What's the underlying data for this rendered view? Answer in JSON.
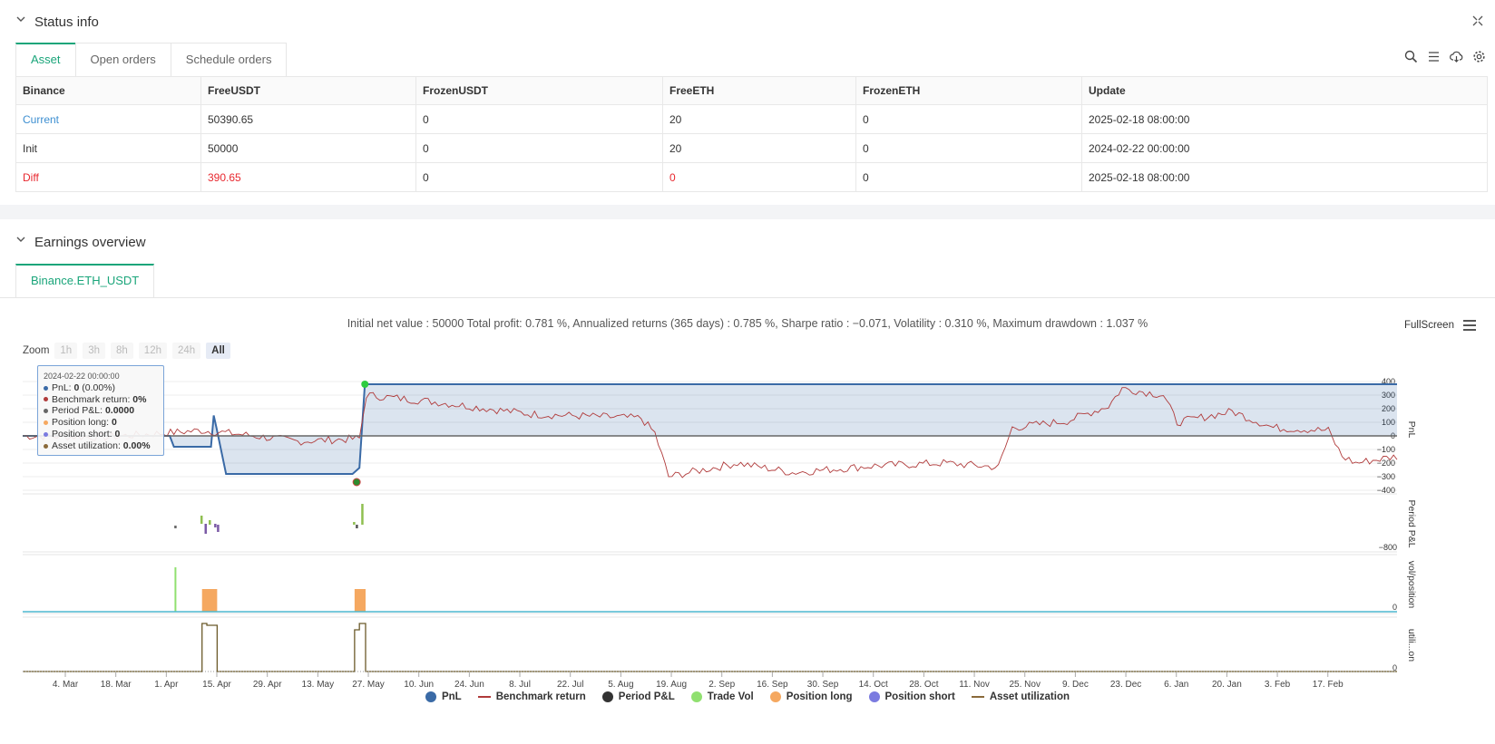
{
  "status": {
    "title": "Status info",
    "tabs": [
      "Asset",
      "Open orders",
      "Schedule orders"
    ],
    "columns": [
      "Binance",
      "FreeUSDT",
      "FrozenUSDT",
      "FreeETH",
      "FrozenETH",
      "Update"
    ],
    "rows": [
      [
        "Current",
        "50390.65",
        "0",
        "20",
        "0",
        "2025-02-18 08:00:00"
      ],
      [
        "Init",
        "50000",
        "0",
        "20",
        "0",
        "2024-02-22 00:00:00"
      ],
      [
        "Diff",
        "390.65",
        "0",
        "0",
        "0",
        "2025-02-18 08:00:00"
      ]
    ]
  },
  "earnings": {
    "title": "Earnings overview",
    "tab": "Binance.ETH_USDT",
    "stats": "Initial net value : 50000 Total profit: 0.781 %, Annualized returns (365 days) : 0.785 %, Sharpe ratio : −0.071, Volatility : 0.310 %, Maximum drawdown : 1.037 %",
    "fullscreen": "FullScreen",
    "zoom_label": "Zoom",
    "zoom_buttons": [
      "1h",
      "3h",
      "8h",
      "12h",
      "24h",
      "All"
    ],
    "zoom_active": "All"
  },
  "tooltip": {
    "date": "2024-02-22 00:00:00",
    "pnl_label": "PnL: ",
    "pnl_value": "0",
    "pnl_extra": " (0.00%)",
    "bench_label": "Benchmark return: ",
    "bench_value": "0%",
    "period_label": "Period P&L: ",
    "period_value": "0.0000",
    "long_label": "Position long: ",
    "long_value": "0",
    "short_label": "Position short: ",
    "short_value": "0",
    "util_label": "Asset utilization: ",
    "util_value": "0.00%"
  },
  "chart_data": {
    "type": "line",
    "x_tick_labels": [
      "4. Mar",
      "18. Mar",
      "1. Apr",
      "15. Apr",
      "29. Apr",
      "13. May",
      "27. May",
      "10. Jun",
      "24. Jun",
      "8. Jul",
      "22. Jul",
      "5. Aug",
      "19. Aug",
      "2. Sep",
      "16. Sep",
      "30. Sep",
      "14. Oct",
      "28. Oct",
      "11. Nov",
      "25. Nov",
      "9. Dec",
      "23. Dec",
      "6. Jan",
      "20. Jan",
      "3. Feb",
      "17. Feb"
    ],
    "pnl_axis": {
      "label": "PnL",
      "ticks": [
        400,
        300,
        200,
        100,
        0,
        -100,
        -200,
        -300,
        -400
      ]
    },
    "period_axis": {
      "label": "Period P&L",
      "ticks": [
        -800
      ]
    },
    "vol_axis": {
      "label": "vol/position",
      "ticks": [
        0
      ]
    },
    "util_axis": {
      "label": "utili...on",
      "ticks": [
        0
      ]
    },
    "pnl_steps": [
      {
        "t": 0,
        "v": 0
      },
      {
        "t": 0.107,
        "v": 0
      },
      {
        "t": 0.11,
        "v": -80
      },
      {
        "t": 0.137,
        "v": -80
      },
      {
        "t": 0.139,
        "v": 150
      },
      {
        "t": 0.141,
        "v": 60
      },
      {
        "t": 0.148,
        "v": -280
      },
      {
        "t": 0.24,
        "v": -280
      },
      {
        "t": 0.245,
        "v": -235
      },
      {
        "t": 0.249,
        "v": 380
      },
      {
        "t": 1.0,
        "v": 380
      }
    ],
    "series": [
      {
        "name": "PnL",
        "color": "#3a6aa6"
      },
      {
        "name": "Benchmark return",
        "color": "#b03a3a"
      },
      {
        "name": "Period P&L",
        "color": "#333333"
      },
      {
        "name": "Trade Vol",
        "color": "#90e070"
      },
      {
        "name": "Position long",
        "color": "#f5a860"
      },
      {
        "name": "Position short",
        "color": "#7b7be0"
      },
      {
        "name": "Asset utilization",
        "color": "#8a6a3a"
      }
    ]
  }
}
